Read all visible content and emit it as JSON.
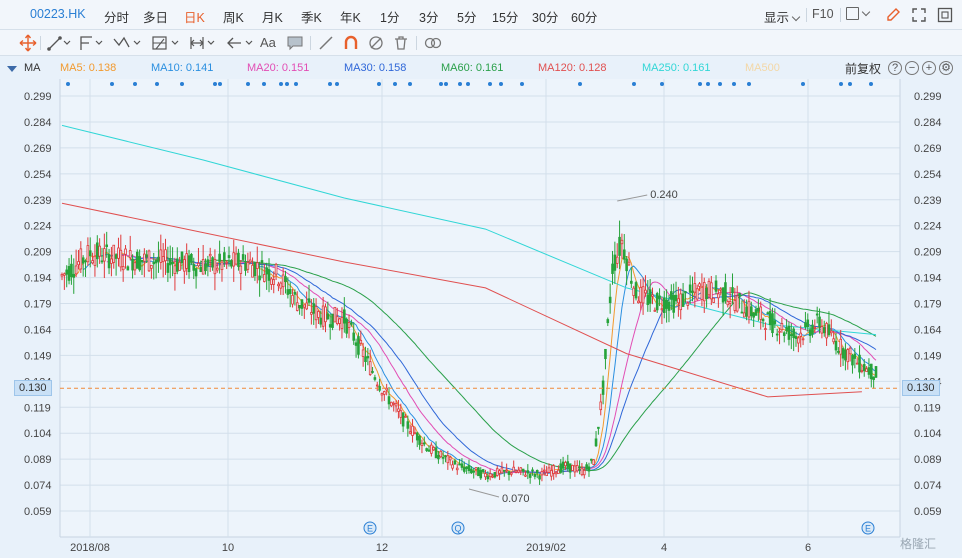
{
  "toolbar": {
    "ticker": "00223.HK",
    "periods": [
      "分时",
      "多日",
      "日K",
      "周K",
      "月K",
      "季K",
      "年K",
      "1分",
      "3分",
      "5分",
      "15分",
      "30分",
      "60分"
    ],
    "active_period": "日K",
    "display_label": "显示",
    "f10_label": "F10"
  },
  "drawbar": {
    "text_tool": "Aa"
  },
  "legend": {
    "indicator": "MA",
    "items": [
      {
        "label": "MA5: 0.138",
        "color": "#f29a2e"
      },
      {
        "label": "MA10: 0.141",
        "color": "#2a8fe0"
      },
      {
        "label": "MA20: 0.151",
        "color": "#e24db4"
      },
      {
        "label": "MA30: 0.158",
        "color": "#2f67d8"
      },
      {
        "label": "MA60: 0.161",
        "color": "#2aa04a"
      },
      {
        "label": "MA120: 0.128",
        "color": "#e05050"
      },
      {
        "label": "MA250: 0.161",
        "color": "#31d6d6"
      },
      {
        "label": "MA500",
        "color": "#f3d7a6"
      }
    ],
    "adjust_label": "前复权"
  },
  "chart_data": {
    "type": "candlestick",
    "y_ticks": [
      "0.299",
      "0.284",
      "0.269",
      "0.254",
      "0.239",
      "0.224",
      "0.209",
      "0.194",
      "0.179",
      "0.164",
      "0.149",
      "0.134",
      "0.119",
      "0.104",
      "0.089",
      "0.074",
      "0.059"
    ],
    "x_ticks": [
      "2018/08",
      "10",
      "12",
      "2019/02",
      "4",
      "6"
    ],
    "ylim": [
      0.054,
      0.304
    ],
    "current_price": "0.130",
    "max_label": "0.240",
    "min_label": "0.070",
    "colors": {
      "up": "#e0393a",
      "down": "#27a33a",
      "grid": "#d3dfeb",
      "current": "#f08a3a"
    }
  },
  "watermark": "格隆汇"
}
